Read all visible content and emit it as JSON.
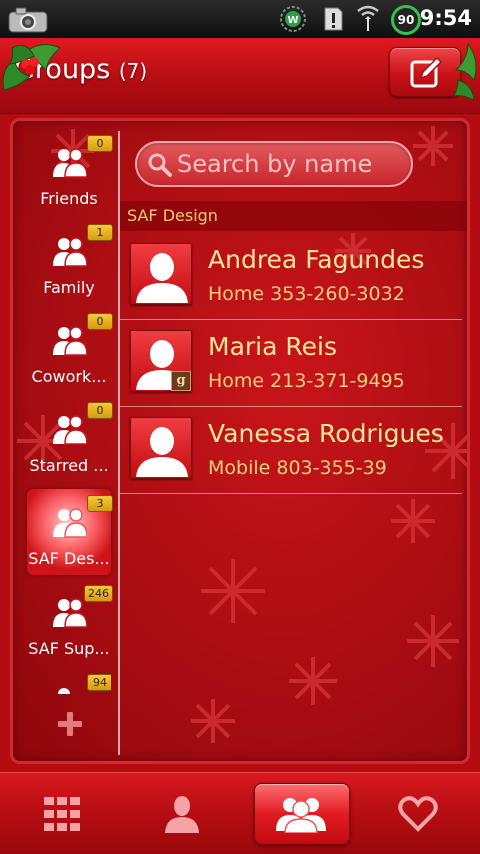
{
  "status_bar": {
    "battery_level": "90",
    "time": "9:54",
    "icons": [
      "camera-icon",
      "widget-w-icon",
      "alert-icon",
      "signal-icon",
      "battery-icon"
    ]
  },
  "header": {
    "title": "Groups",
    "count": "(7)",
    "edit_icon": "edit-icon"
  },
  "groups": [
    {
      "label": "Friends",
      "badge": "0",
      "active": false
    },
    {
      "label": "Family",
      "badge": "1",
      "active": false
    },
    {
      "label": "Cowork...",
      "badge": "0",
      "active": false
    },
    {
      "label": "Starred ...",
      "badge": "0",
      "active": false
    },
    {
      "label": "SAF Des...",
      "badge": "3",
      "active": true
    },
    {
      "label": "SAF Sup...",
      "badge": "246",
      "active": false
    },
    {
      "label": "",
      "badge": "94",
      "active": false
    }
  ],
  "search": {
    "placeholder": "Search by name",
    "value": ""
  },
  "section_header": "SAF Design",
  "contacts": [
    {
      "name": "Andrea Fagundes",
      "phone": "Home 353-260-3032",
      "has_google_badge": false
    },
    {
      "name": "Maria Reis",
      "phone": "Home 213-371-9495",
      "has_google_badge": true,
      "google_badge": "g"
    },
    {
      "name": "Vanessa Rodrigues",
      "phone": "Mobile 803-355-39",
      "has_google_badge": false
    }
  ],
  "bottom_tabs": [
    {
      "icon": "dialpad-icon",
      "active": false
    },
    {
      "icon": "contact-icon",
      "active": false
    },
    {
      "icon": "groups-icon",
      "active": true
    },
    {
      "icon": "favorites-heart-icon",
      "active": false
    }
  ],
  "colors": {
    "accent_red": "#c8151b",
    "name_text": "#ffe79a",
    "badge_gold": "#e9b526"
  }
}
